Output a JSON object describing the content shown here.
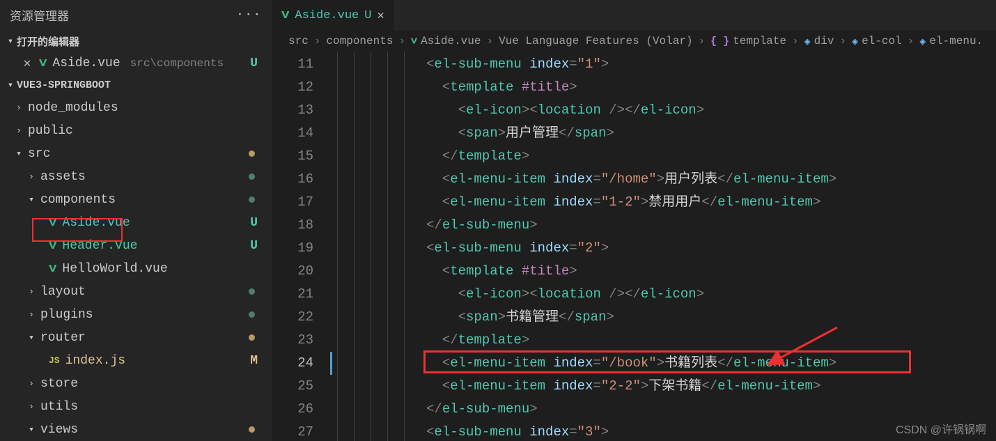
{
  "sidebar": {
    "title": "资源管理器",
    "openEditorsLabel": "打开的编辑器",
    "openEditor": {
      "file": "Aside.vue",
      "dir": "src\\components",
      "status": "U"
    },
    "projectLabel": "VUE3-SPRINGBOOT",
    "tree": [
      {
        "kind": "folder",
        "name": "node_modules",
        "depth": 0,
        "open": false,
        "dot": ""
      },
      {
        "kind": "folder",
        "name": "public",
        "depth": 0,
        "open": false,
        "dot": ""
      },
      {
        "kind": "folder",
        "name": "src",
        "depth": 0,
        "open": true,
        "dot": "dot-mod"
      },
      {
        "kind": "folder",
        "name": "assets",
        "depth": 1,
        "open": false,
        "dot": "dot-unt"
      },
      {
        "kind": "folder",
        "name": "components",
        "depth": 1,
        "open": true,
        "dot": "dot-unt"
      },
      {
        "kind": "vue",
        "name": "Aside.vue",
        "depth": 2,
        "status": "U",
        "color": "#4ec9b0"
      },
      {
        "kind": "vue",
        "name": "Header.vue",
        "depth": 2,
        "status": "U",
        "color": "#4ec9b0"
      },
      {
        "kind": "vue",
        "name": "HelloWorld.vue",
        "depth": 2,
        "status": "",
        "color": "#cccccc"
      },
      {
        "kind": "folder",
        "name": "layout",
        "depth": 1,
        "open": false,
        "dot": "dot-unt"
      },
      {
        "kind": "folder",
        "name": "plugins",
        "depth": 1,
        "open": false,
        "dot": "dot-unt"
      },
      {
        "kind": "folder",
        "name": "router",
        "depth": 1,
        "open": true,
        "dot": "dot-mod"
      },
      {
        "kind": "js",
        "name": "index.js",
        "depth": 2,
        "status": "M",
        "color": "#e2c08d"
      },
      {
        "kind": "folder",
        "name": "store",
        "depth": 1,
        "open": false,
        "dot": ""
      },
      {
        "kind": "folder",
        "name": "utils",
        "depth": 1,
        "open": false,
        "dot": ""
      },
      {
        "kind": "folder",
        "name": "views",
        "depth": 1,
        "open": true,
        "dot": "dot-mod"
      }
    ],
    "highlightedIndex": 5
  },
  "tab": {
    "file": "Aside.vue",
    "status": "U"
  },
  "breadcrumbs": [
    {
      "text": "src"
    },
    {
      "text": "components"
    },
    {
      "text": "Aside.vue",
      "icon": "vue"
    },
    {
      "text": "Vue Language Features (Volar)"
    },
    {
      "text": "template",
      "icon": "braces"
    },
    {
      "text": "div",
      "icon": "cube"
    },
    {
      "text": "el-col",
      "icon": "cube"
    },
    {
      "text": "el-menu",
      "icon": "cube",
      "trunc": true
    }
  ],
  "code": {
    "startLine": 11,
    "activeLine": 24,
    "highlightLine": 24,
    "lines": [
      [
        [
          "br",
          "<"
        ],
        [
          "tag",
          "el-sub-menu"
        ],
        [
          "txt",
          " "
        ],
        [
          "attr",
          "index"
        ],
        [
          "br",
          "="
        ],
        [
          "str",
          "\"1\""
        ],
        [
          "br",
          ">"
        ]
      ],
      [
        [
          "br",
          "  <"
        ],
        [
          "tag",
          "template"
        ],
        [
          "txt",
          " "
        ],
        [
          "dir",
          "#title"
        ],
        [
          "br",
          ">"
        ]
      ],
      [
        [
          "br",
          "    <"
        ],
        [
          "tag",
          "el-icon"
        ],
        [
          "br",
          "><"
        ],
        [
          "tag",
          "location"
        ],
        [
          "txt",
          " "
        ],
        [
          "br",
          "/></"
        ],
        [
          "tag",
          "el-icon"
        ],
        [
          "br",
          ">"
        ]
      ],
      [
        [
          "br",
          "    <"
        ],
        [
          "tag",
          "span"
        ],
        [
          "br",
          ">"
        ],
        [
          "txt",
          "用户管理"
        ],
        [
          "br",
          "</"
        ],
        [
          "tag",
          "span"
        ],
        [
          "br",
          ">"
        ]
      ],
      [
        [
          "br",
          "  </"
        ],
        [
          "tag",
          "template"
        ],
        [
          "br",
          ">"
        ]
      ],
      [
        [
          "br",
          "  <"
        ],
        [
          "tag",
          "el-menu-item"
        ],
        [
          "txt",
          " "
        ],
        [
          "attr",
          "index"
        ],
        [
          "br",
          "="
        ],
        [
          "str",
          "\"/home\""
        ],
        [
          "br",
          ">"
        ],
        [
          "txt",
          "用户列表"
        ],
        [
          "br",
          "</"
        ],
        [
          "tag",
          "el-menu-item"
        ],
        [
          "br",
          ">"
        ]
      ],
      [
        [
          "br",
          "  <"
        ],
        [
          "tag",
          "el-menu-item"
        ],
        [
          "txt",
          " "
        ],
        [
          "attr",
          "index"
        ],
        [
          "br",
          "="
        ],
        [
          "str",
          "\"1-2\""
        ],
        [
          "br",
          ">"
        ],
        [
          "txt",
          "禁用用户"
        ],
        [
          "br",
          "</"
        ],
        [
          "tag",
          "el-menu-item"
        ],
        [
          "br",
          ">"
        ]
      ],
      [
        [
          "br",
          "</"
        ],
        [
          "tag",
          "el-sub-menu"
        ],
        [
          "br",
          ">"
        ]
      ],
      [
        [
          "br",
          "<"
        ],
        [
          "tag",
          "el-sub-menu"
        ],
        [
          "txt",
          " "
        ],
        [
          "attr",
          "index"
        ],
        [
          "br",
          "="
        ],
        [
          "str",
          "\"2\""
        ],
        [
          "br",
          ">"
        ]
      ],
      [
        [
          "br",
          "  <"
        ],
        [
          "tag",
          "template"
        ],
        [
          "txt",
          " "
        ],
        [
          "dir",
          "#title"
        ],
        [
          "br",
          ">"
        ]
      ],
      [
        [
          "br",
          "    <"
        ],
        [
          "tag",
          "el-icon"
        ],
        [
          "br",
          "><"
        ],
        [
          "tag",
          "location"
        ],
        [
          "txt",
          " "
        ],
        [
          "br",
          "/></"
        ],
        [
          "tag",
          "el-icon"
        ],
        [
          "br",
          ">"
        ]
      ],
      [
        [
          "br",
          "    <"
        ],
        [
          "tag",
          "span"
        ],
        [
          "br",
          ">"
        ],
        [
          "txt",
          "书籍管理"
        ],
        [
          "br",
          "</"
        ],
        [
          "tag",
          "span"
        ],
        [
          "br",
          ">"
        ]
      ],
      [
        [
          "br",
          "  </"
        ],
        [
          "tag",
          "template"
        ],
        [
          "br",
          ">"
        ]
      ],
      [
        [
          "br",
          "  <"
        ],
        [
          "tag",
          "el-menu-item"
        ],
        [
          "txt",
          " "
        ],
        [
          "attr",
          "index"
        ],
        [
          "br",
          "="
        ],
        [
          "str",
          "\"/book\""
        ],
        [
          "br",
          ">"
        ],
        [
          "txt",
          "书籍列表"
        ],
        [
          "br",
          "</"
        ],
        [
          "tag",
          "el-menu-item"
        ],
        [
          "br",
          ">"
        ]
      ],
      [
        [
          "br",
          "  <"
        ],
        [
          "tag",
          "el-menu-item"
        ],
        [
          "txt",
          " "
        ],
        [
          "attr",
          "index"
        ],
        [
          "br",
          "="
        ],
        [
          "str",
          "\"2-2\""
        ],
        [
          "br",
          ">"
        ],
        [
          "txt",
          "下架书籍"
        ],
        [
          "br",
          "</"
        ],
        [
          "tag",
          "el-menu-item"
        ],
        [
          "br",
          ">"
        ]
      ],
      [
        [
          "br",
          "</"
        ],
        [
          "tag",
          "el-sub-menu"
        ],
        [
          "br",
          ">"
        ]
      ],
      [
        [
          "br",
          "<"
        ],
        [
          "tag",
          "el-sub-menu"
        ],
        [
          "txt",
          " "
        ],
        [
          "attr",
          "index"
        ],
        [
          "br",
          "="
        ],
        [
          "str",
          "\"3\""
        ],
        [
          "br",
          ">"
        ]
      ]
    ]
  },
  "watermark": "CSDN @许锅锅啊"
}
